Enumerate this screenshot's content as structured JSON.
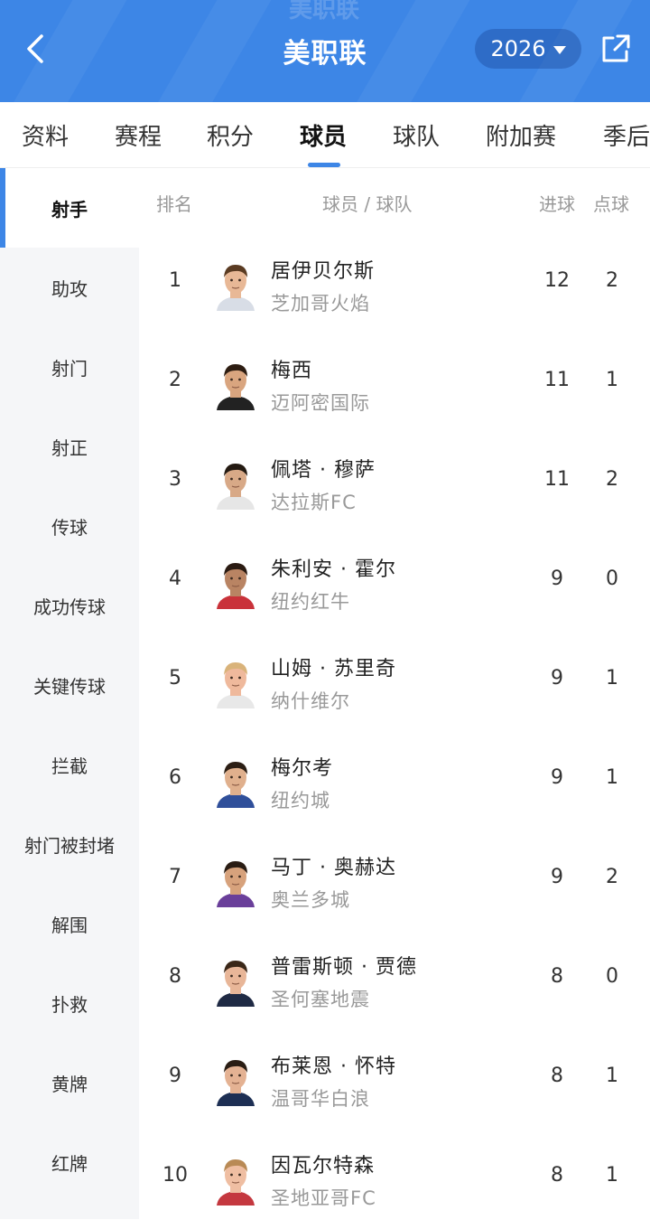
{
  "header": {
    "title": "美职联",
    "ghost_text": "美职联",
    "year": "2026",
    "back_icon": "chevron-left-icon",
    "share_icon": "share-icon",
    "accent": "#3d86e6"
  },
  "tabs": [
    {
      "label": "资料"
    },
    {
      "label": "赛程"
    },
    {
      "label": "积分"
    },
    {
      "label": "球员",
      "active": true
    },
    {
      "label": "球队"
    },
    {
      "label": "附加赛"
    },
    {
      "label": "季后"
    }
  ],
  "sidebar": {
    "items": [
      {
        "label": "射手",
        "active": true
      },
      {
        "label": "助攻"
      },
      {
        "label": "射门"
      },
      {
        "label": "射正"
      },
      {
        "label": "传球"
      },
      {
        "label": "成功传球"
      },
      {
        "label": "关键传球"
      },
      {
        "label": "拦截"
      },
      {
        "label": "射门被封堵"
      },
      {
        "label": "解围"
      },
      {
        "label": "扑救"
      },
      {
        "label": "黄牌"
      },
      {
        "label": "红牌"
      }
    ]
  },
  "table": {
    "headers": {
      "rank": "排名",
      "player_team": "球员 / 球队",
      "goals": "进球",
      "penalties": "点球"
    },
    "rows": [
      {
        "rank": "1",
        "name": "居伊贝尔斯",
        "team": "芝加哥火焰",
        "goals": "12",
        "penalties": "2",
        "skin": "#e8b896",
        "hair": "#5a3b22",
        "shirt": "#d8dde6"
      },
      {
        "rank": "2",
        "name": "梅西",
        "team": "迈阿密国际",
        "goals": "11",
        "penalties": "1",
        "skin": "#d9a57f",
        "hair": "#2d1d12",
        "shirt": "#222222"
      },
      {
        "rank": "3",
        "name": "佩塔 · 穆萨",
        "team": "达拉斯FC",
        "goals": "11",
        "penalties": "2",
        "skin": "#d8a987",
        "hair": "#241a12",
        "shirt": "#e6e6e6"
      },
      {
        "rank": "4",
        "name": "朱利安 · 霍尔",
        "team": "纽约红牛",
        "goals": "9",
        "penalties": "0",
        "skin": "#b98463",
        "hair": "#2a1b12",
        "shirt": "#c9323a"
      },
      {
        "rank": "5",
        "name": "山姆 · 苏里奇",
        "team": "纳什维尔",
        "goals": "9",
        "penalties": "1",
        "skin": "#efb99c",
        "hair": "#d9b37a",
        "shirt": "#e8e8e8"
      },
      {
        "rank": "6",
        "name": "梅尔考",
        "team": "纽约城",
        "goals": "9",
        "penalties": "1",
        "skin": "#e0b08d",
        "hair": "#2b1e14",
        "shirt": "#2f4f9a"
      },
      {
        "rank": "7",
        "name": "马丁 · 奥赫达",
        "team": "奥兰多城",
        "goals": "9",
        "penalties": "2",
        "skin": "#d7a27c",
        "hair": "#2a1d14",
        "shirt": "#6a3f9a"
      },
      {
        "rank": "8",
        "name": "普雷斯顿 · 贾德",
        "team": "圣何塞地震",
        "goals": "8",
        "penalties": "0",
        "skin": "#e8b698",
        "hair": "#3a2718",
        "shirt": "#1f2a44"
      },
      {
        "rank": "9",
        "name": "布莱恩 · 怀特",
        "team": "温哥华白浪",
        "goals": "8",
        "penalties": "1",
        "skin": "#e4b293",
        "hair": "#2a1d14",
        "shirt": "#1d2f54"
      },
      {
        "rank": "10",
        "name": "因瓦尔特森",
        "team": "圣地亚哥FC",
        "goals": "8",
        "penalties": "1",
        "skin": "#efbea2",
        "hair": "#b98a55",
        "shirt": "#c4383f"
      }
    ]
  }
}
